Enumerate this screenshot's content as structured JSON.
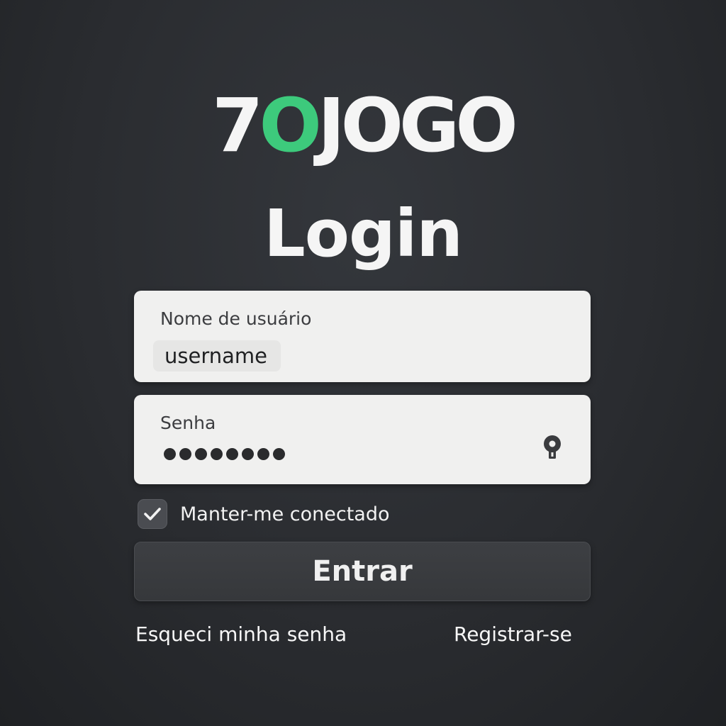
{
  "logo": {
    "part1": "7",
    "accent": "O",
    "part2": "JOGO",
    "accent_color": "#3dca7c"
  },
  "title": "Login",
  "username_field": {
    "label": "Nome de usuário",
    "value": "username"
  },
  "password_field": {
    "label": "Senha",
    "masked_length": 8,
    "icon": "key-hole-icon"
  },
  "remember_me": {
    "label": "Manter-me conectado",
    "checked": true
  },
  "submit_button": {
    "label": "Entrar"
  },
  "links": {
    "forgot_password": "Esqueci minha senha",
    "register": "Registrar-se"
  }
}
